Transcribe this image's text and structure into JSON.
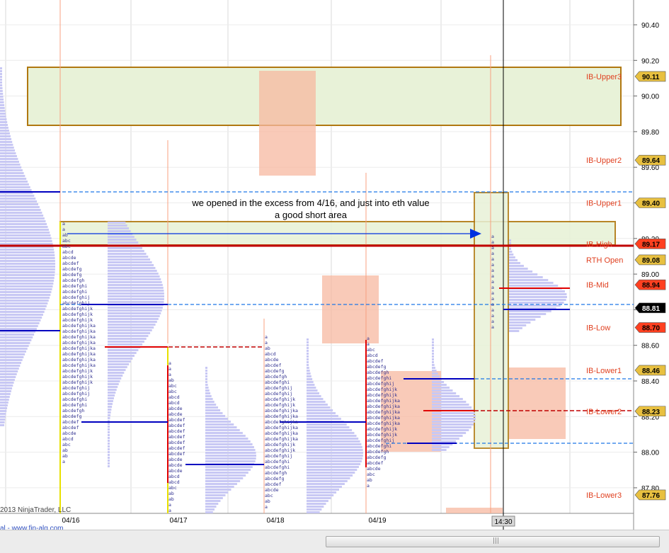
{
  "window": {
    "title_fragment": ""
  },
  "chart_data": {
    "type": "market-profile",
    "price_axis": {
      "min": 87.7,
      "max": 90.5,
      "ticks": [
        "90.40",
        "90.20",
        "90.00",
        "89.80",
        "89.60",
        "89.40",
        "89.20",
        "89.00",
        "88.80",
        "88.60",
        "88.40",
        "88.20",
        "88.00",
        "87.80"
      ]
    },
    "date_labels": [
      "04/16",
      "04/17",
      "04/18",
      "04/19"
    ],
    "crosshair_time": "14:30",
    "levels": [
      {
        "name": "IB-Upper3",
        "value": "90.11",
        "price": 90.11,
        "color": "#d8a000"
      },
      {
        "name": "IB-Upper2",
        "value": "89.64",
        "price": 89.64,
        "color": "#d8a000"
      },
      {
        "name": "IB-Upper1",
        "value": "89.40",
        "price": 89.4,
        "color": "#d8a000"
      },
      {
        "name": "IB-High",
        "value": "89.17",
        "price": 89.17,
        "color": "#ff3030"
      },
      {
        "name": "RTH Open",
        "value": "89.08",
        "price": 89.08,
        "color": "#d8a000"
      },
      {
        "name": "IB-Mid",
        "value": "88.94",
        "price": 88.94,
        "color": "#ff3030"
      },
      {
        "name": "",
        "value": "88.81",
        "price": 88.81,
        "color": "#000000"
      },
      {
        "name": "IB-Low",
        "value": "88.70",
        "price": 88.7,
        "color": "#ff3030"
      },
      {
        "name": "IB-Lower1",
        "value": "88.46",
        "price": 88.46,
        "color": "#d8a000"
      },
      {
        "name": "IB-Lower2",
        "value": "88.23",
        "price": 88.23,
        "color": "#d8a000"
      },
      {
        "name": "IB-Lower3",
        "value": "87.76",
        "price": 87.76,
        "color": "#d8a000"
      }
    ],
    "annotation": [
      "we opened in the excess from 4/16, and just into eth value",
      "a good short area"
    ],
    "copyright": "2013 NinjaTrader, LLC",
    "website": "al - www.fin-alg.com",
    "colors": {
      "value_box": "#e8f2d8",
      "box_border": "#b07810",
      "excess": "#f7b8a0",
      "profile": "#c8c8f4",
      "poc": "#0000c0",
      "value_line": "#1e78e6",
      "ib_high": "#c00000",
      "price_red": "#e00000"
    }
  }
}
